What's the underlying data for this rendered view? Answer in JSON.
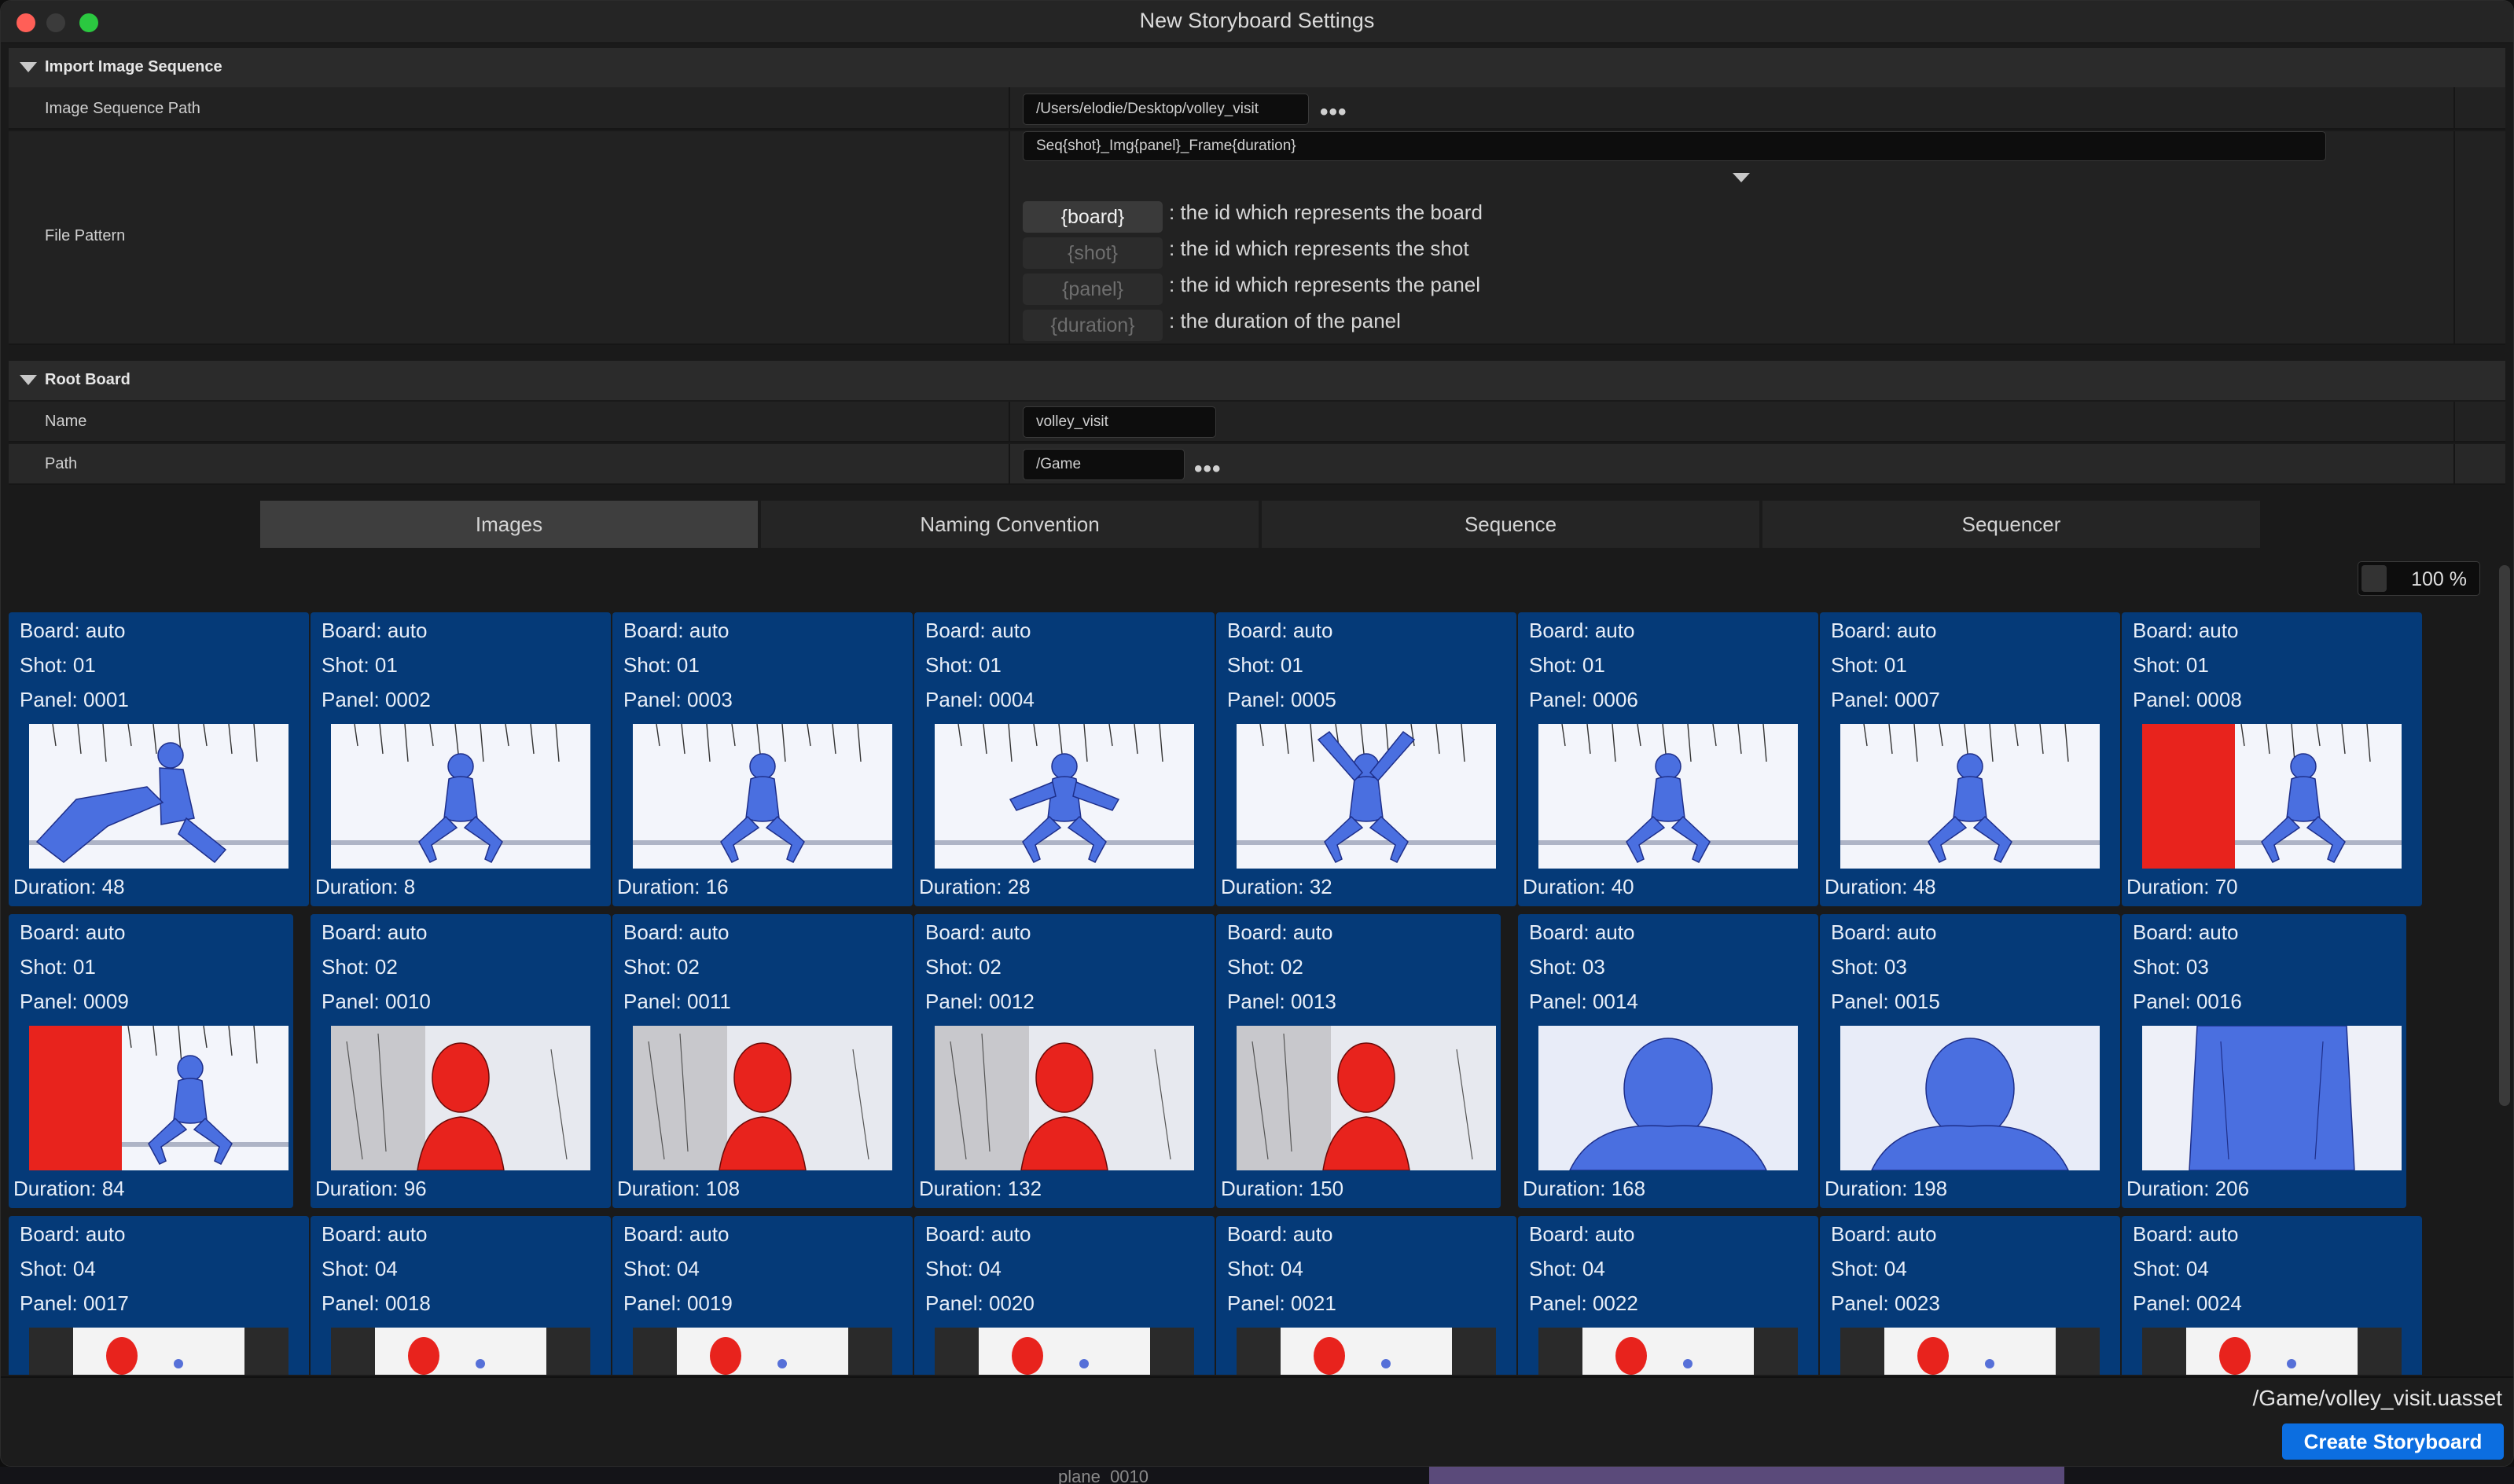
{
  "window": {
    "title": "New Storyboard Settings"
  },
  "import_section": {
    "title": "Import Image Sequence",
    "path_label": "Image Sequence Path",
    "path_value": "/Users/elodie/Desktop/volley_visit",
    "pattern_label": "File Pattern",
    "pattern_value": "Seq{shot}_Img{panel}_Frame{duration}",
    "tokens": [
      {
        "token": "{board}",
        "desc": ": the id which represents the board",
        "active": true
      },
      {
        "token": "{shot}",
        "desc": ": the id which represents the shot",
        "active": false
      },
      {
        "token": "{panel}",
        "desc": ": the id which represents the panel",
        "active": false
      },
      {
        "token": "{duration}",
        "desc": ": the duration of the panel",
        "active": false
      }
    ]
  },
  "root_board": {
    "title": "Root Board",
    "name_label": "Name",
    "name_value": "volley_visit",
    "path_label": "Path",
    "path_value": "/Game"
  },
  "browse_glyph": "•••",
  "tabs": [
    "Images",
    "Naming Convention",
    "Sequence",
    "Sequencer"
  ],
  "active_tab": "Images",
  "zoom": "100 %",
  "panels": [
    {
      "board": "Board: auto",
      "shot": "Shot: 01",
      "panel": "Panel: 0001",
      "duration": "Duration: 48",
      "art": "blue-wide"
    },
    {
      "board": "Board: auto",
      "shot": "Shot: 01",
      "panel": "Panel: 0002",
      "duration": "Duration: 8",
      "art": "blue-crouch"
    },
    {
      "board": "Board: auto",
      "shot": "Shot: 01",
      "panel": "Panel: 0003",
      "duration": "Duration: 16",
      "art": "blue-crouch"
    },
    {
      "board": "Board: auto",
      "shot": "Shot: 01",
      "panel": "Panel: 0004",
      "duration": "Duration: 28",
      "art": "blue-arms"
    },
    {
      "board": "Board: auto",
      "shot": "Shot: 01",
      "panel": "Panel: 0005",
      "duration": "Duration: 32",
      "art": "blue-arms-up"
    },
    {
      "board": "Board: auto",
      "shot": "Shot: 01",
      "panel": "Panel: 0006",
      "duration": "Duration: 40",
      "art": "blue-crouch"
    },
    {
      "board": "Board: auto",
      "shot": "Shot: 01",
      "panel": "Panel: 0007",
      "duration": "Duration: 48",
      "art": "blue-crouch"
    },
    {
      "board": "Board: auto",
      "shot": "Shot: 01",
      "panel": "Panel: 0008",
      "duration": "Duration: 70",
      "art": "red-left-blue"
    },
    {
      "board": "Board: auto",
      "shot": "Shot: 01",
      "panel": "Panel: 0009",
      "duration": "Duration: 84",
      "art": "red-left-blue"
    },
    {
      "board": "Board: auto",
      "shot": "Shot: 02",
      "panel": "Panel: 0010",
      "duration": "Duration: 96",
      "art": "red-portrait"
    },
    {
      "board": "Board: auto",
      "shot": "Shot: 02",
      "panel": "Panel: 0011",
      "duration": "Duration: 108",
      "art": "red-portrait"
    },
    {
      "board": "Board: auto",
      "shot": "Shot: 02",
      "panel": "Panel: 0012",
      "duration": "Duration: 132",
      "art": "red-portrait"
    },
    {
      "board": "Board: auto",
      "shot": "Shot: 02",
      "panel": "Panel: 0013",
      "duration": "Duration: 150",
      "art": "red-portrait"
    },
    {
      "board": "Board: auto",
      "shot": "Shot: 03",
      "panel": "Panel: 0014",
      "duration": "Duration: 168",
      "art": "blue-close"
    },
    {
      "board": "Board: auto",
      "shot": "Shot: 03",
      "panel": "Panel: 0015",
      "duration": "Duration: 198",
      "art": "blue-close"
    },
    {
      "board": "Board: auto",
      "shot": "Shot: 03",
      "panel": "Panel: 0016",
      "duration": "Duration: 206",
      "art": "blue-torso"
    },
    {
      "board": "Board: auto",
      "shot": "Shot: 04",
      "panel": "Panel: 0017",
      "duration": "",
      "art": "dark-red-head"
    },
    {
      "board": "Board: auto",
      "shot": "Shot: 04",
      "panel": "Panel: 0018",
      "duration": "",
      "art": "dark-red-head"
    },
    {
      "board": "Board: auto",
      "shot": "Shot: 04",
      "panel": "Panel: 0019",
      "duration": "",
      "art": "dark-red-head"
    },
    {
      "board": "Board: auto",
      "shot": "Shot: 04",
      "panel": "Panel: 0020",
      "duration": "",
      "art": "dark-red-head"
    },
    {
      "board": "Board: auto",
      "shot": "Shot: 04",
      "panel": "Panel: 0021",
      "duration": "",
      "art": "dark-red-head"
    },
    {
      "board": "Board: auto",
      "shot": "Shot: 04",
      "panel": "Panel: 0022",
      "duration": "",
      "art": "dark-red-head"
    },
    {
      "board": "Board: auto",
      "shot": "Shot: 04",
      "panel": "Panel: 0023",
      "duration": "",
      "art": "dark-red-head"
    },
    {
      "board": "Board: auto",
      "shot": "Shot: 04",
      "panel": "Panel: 0024",
      "duration": "",
      "art": "dark-red-head"
    }
  ],
  "footer": {
    "asset_path": "/Game/volley_visit.uasset",
    "create_label": "Create Storyboard"
  },
  "background_text": "plane_0010",
  "colors": {
    "card": "#053a78",
    "accent": "#0c6ee0",
    "sketch_blue": "#4a6fe0",
    "sketch_red": "#e8231d"
  }
}
